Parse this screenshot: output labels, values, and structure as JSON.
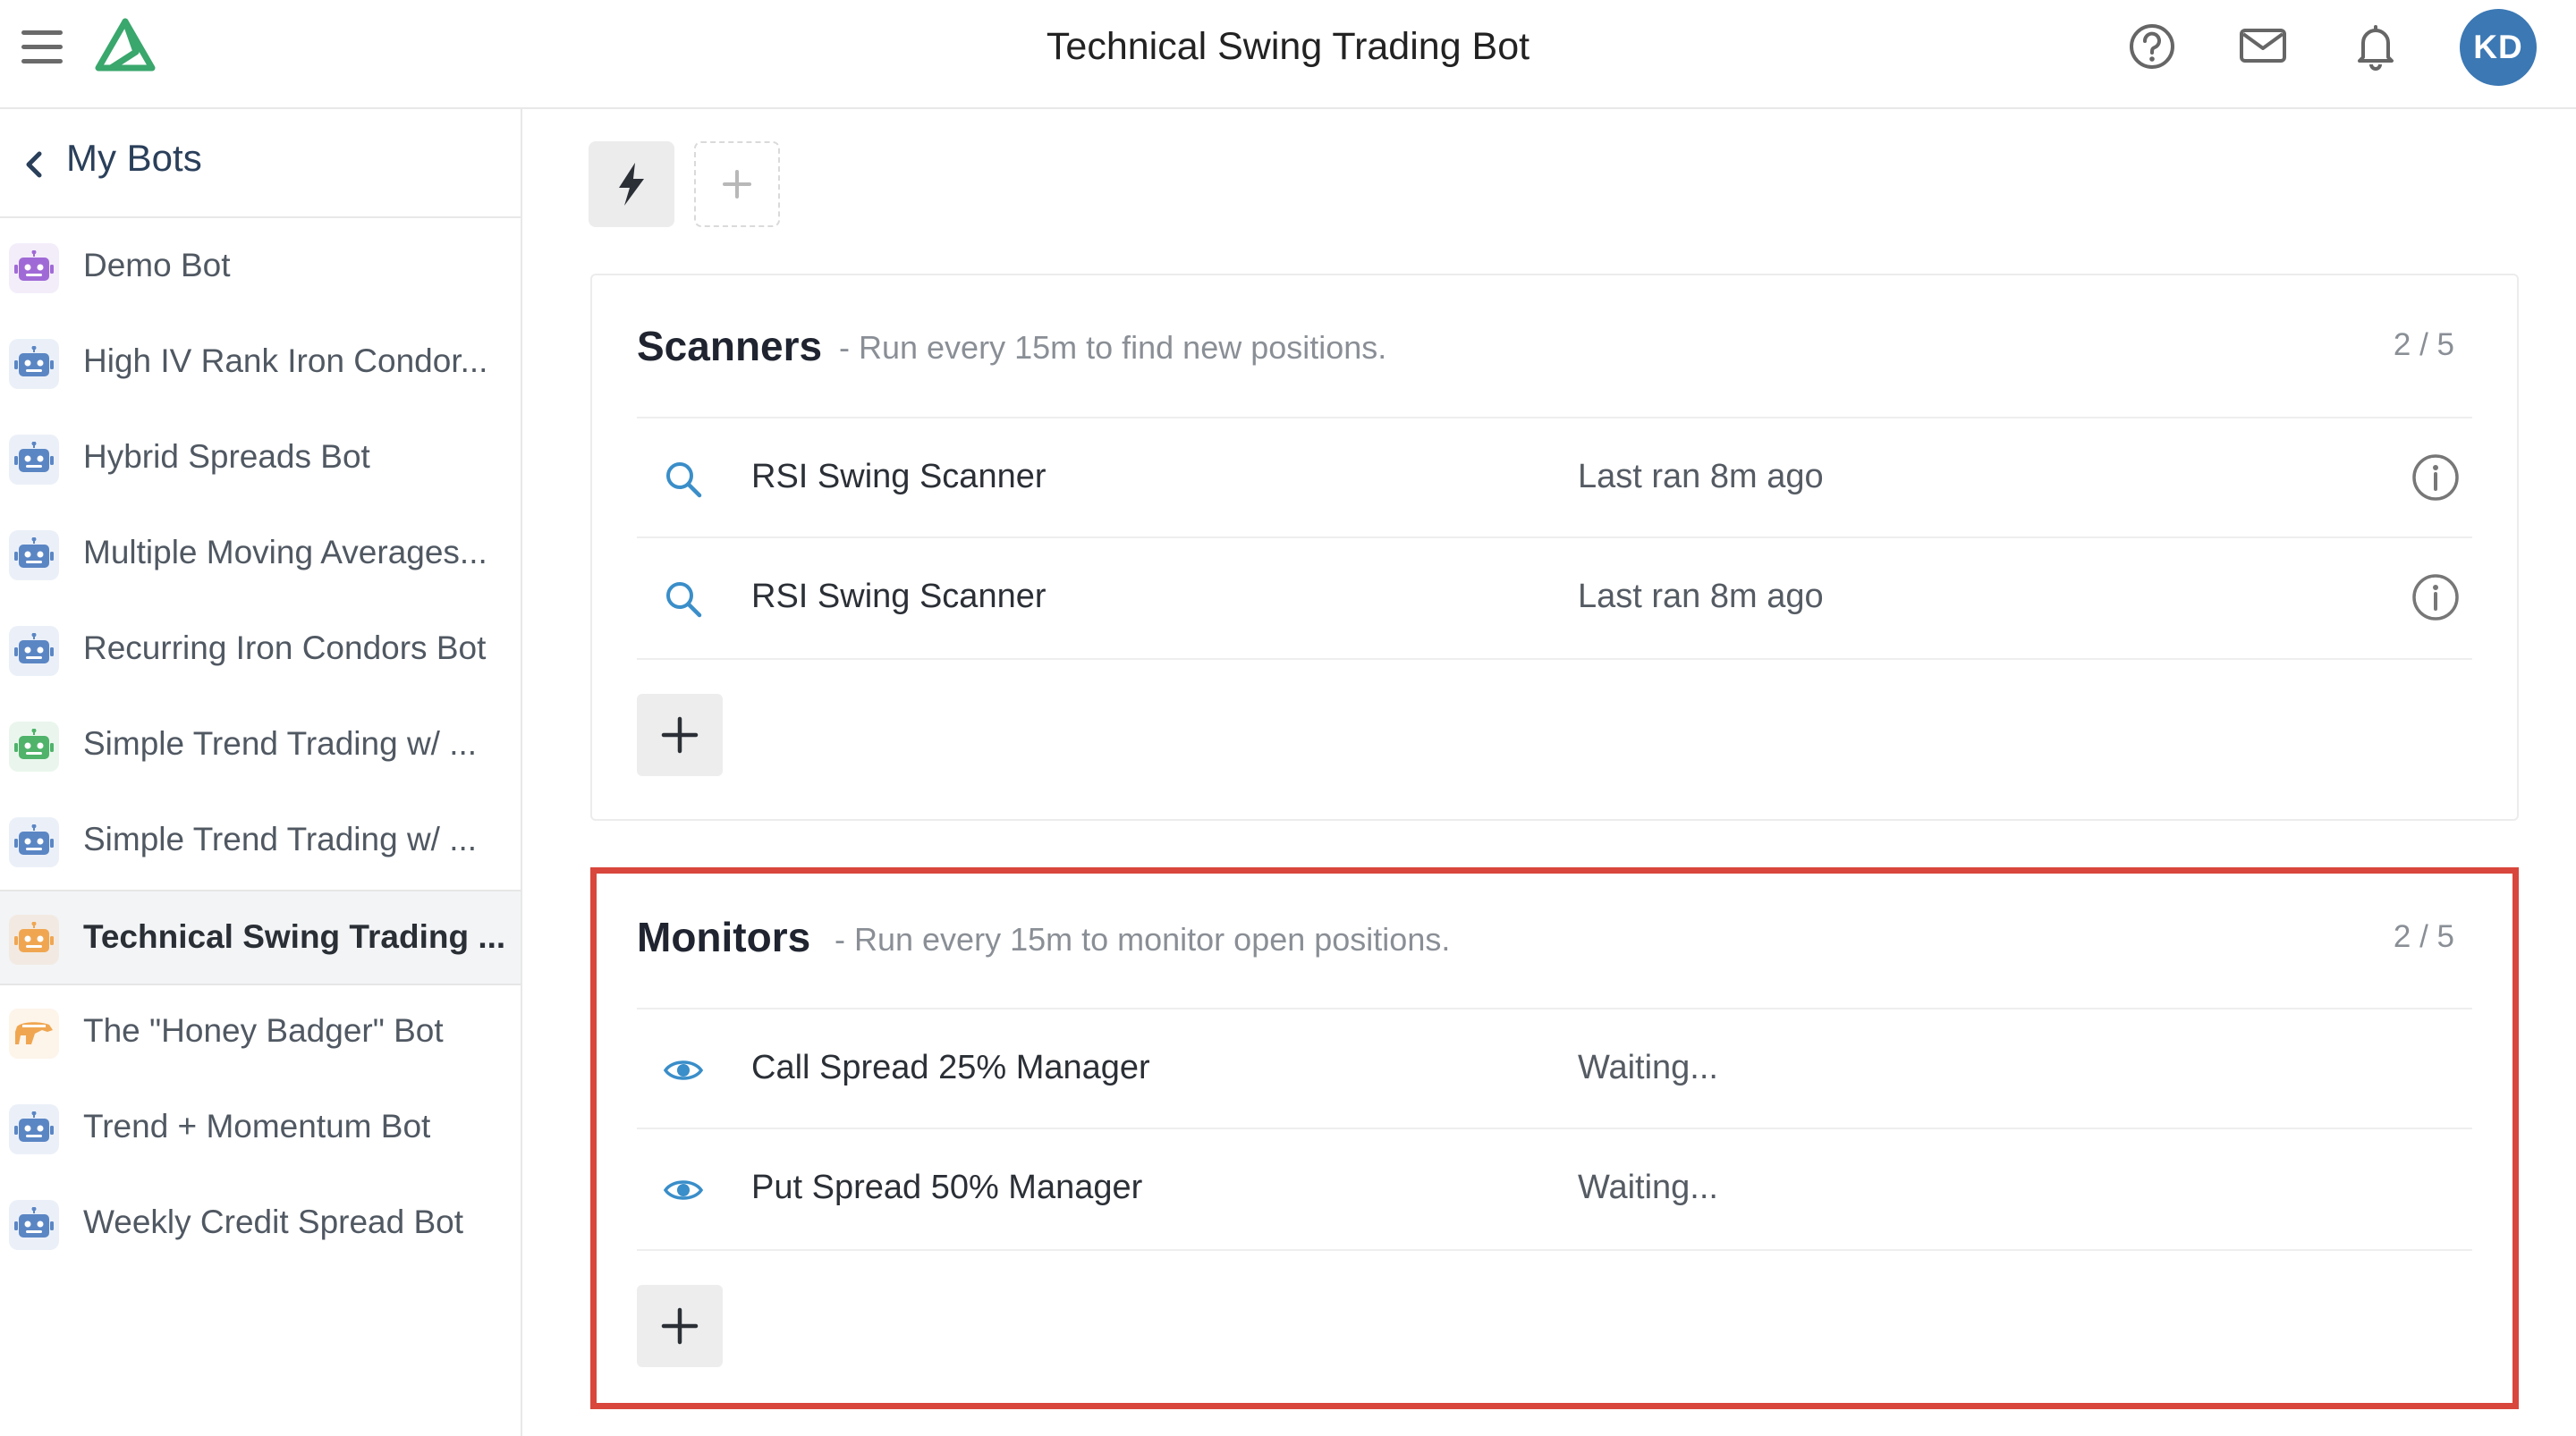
{
  "header": {
    "title": "Technical Swing Trading Bot",
    "avatar_initials": "KD",
    "icons": [
      "menu-icon",
      "logo-icon",
      "help-icon",
      "mail-icon",
      "bell-icon"
    ],
    "brand_color": "#3aa76d",
    "avatar_color": "#3b78b4"
  },
  "sidebar": {
    "back_label": "My Bots",
    "items": [
      {
        "label": "Demo Bot",
        "color": "#a06ad6"
      },
      {
        "label": "High IV Rank Iron Condor...",
        "color": "#5b86c4"
      },
      {
        "label": "Hybrid Spreads Bot",
        "color": "#5b86c4"
      },
      {
        "label": "Multiple Moving Averages...",
        "color": "#5b86c4"
      },
      {
        "label": "Recurring Iron Condors Bot",
        "color": "#5b86c4"
      },
      {
        "label": "Simple Trend Trading w/ ...",
        "color": "#4fb36a"
      },
      {
        "label": "Simple Trend Trading w/ ...",
        "color": "#5b86c4"
      },
      {
        "label": "Technical Swing Trading ...",
        "color": "#f0a651",
        "active": true
      },
      {
        "label": "The \"Honey Badger\" Bot",
        "color": "#f0a651",
        "icon": "badger-icon"
      },
      {
        "label": "Trend + Momentum Bot",
        "color": "#5b86c4"
      },
      {
        "label": "Weekly Credit Spread Bot",
        "color": "#5b86c4"
      }
    ]
  },
  "toolbar": {
    "icons": [
      "bolt-icon",
      "plus-icon"
    ]
  },
  "scanners": {
    "title": "Scanners",
    "subtitle": "- Run every 15m to find new positions.",
    "count": "2 / 5",
    "rows": [
      {
        "name": "RSI Swing Scanner",
        "status": "Last ran 8m ago"
      },
      {
        "name": "RSI Swing Scanner",
        "status": "Last ran 8m ago"
      }
    ]
  },
  "monitors": {
    "title": "Monitors",
    "subtitle": "- Run every 15m to monitor open positions.",
    "count": "2 / 5",
    "highlight_color": "#d9463c",
    "rows": [
      {
        "name": "Call Spread 25% Manager",
        "status": "Waiting..."
      },
      {
        "name": "Put Spread 50% Manager",
        "status": "Waiting..."
      }
    ]
  }
}
